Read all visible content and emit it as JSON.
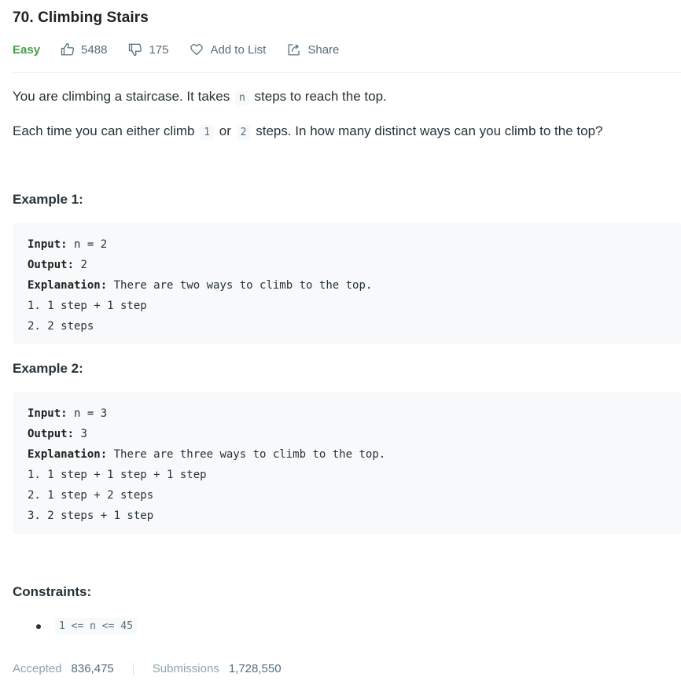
{
  "problem": {
    "title": "70. Climbing Stairs",
    "difficulty": "Easy",
    "likes": "5488",
    "dislikes": "175",
    "add_to_list_label": "Add to List",
    "share_label": "Share"
  },
  "description": {
    "p1": {
      "before": "You are climbing a staircase. It takes",
      "code": "n",
      "after": "steps to reach the top."
    },
    "p2": {
      "before": "Each time you can either climb",
      "code1": "1",
      "mid": "or",
      "code2": "2",
      "after": "steps. In how many distinct ways can you climb to the top?"
    }
  },
  "examples": [
    {
      "heading": "Example 1:",
      "input_label": "Input:",
      "input_value": "n = 2",
      "output_label": "Output:",
      "output_value": "2",
      "explanation_label": "Explanation:",
      "explanation_value": "There are two ways to climb to the top.",
      "lines": [
        "1. 1 step + 1 step",
        "2. 2 steps"
      ]
    },
    {
      "heading": "Example 2:",
      "input_label": "Input:",
      "input_value": "n = 3",
      "output_label": "Output:",
      "output_value": "3",
      "explanation_label": "Explanation:",
      "explanation_value": "There are three ways to climb to the top.",
      "lines": [
        "1. 1 step + 1 step + 1 step",
        "2. 1 step + 2 steps",
        "3. 2 steps + 1 step"
      ]
    }
  ],
  "constraints": {
    "heading": "Constraints:",
    "items": [
      "1 <= n <= 45"
    ]
  },
  "stats": {
    "accepted_label": "Accepted",
    "accepted_value": "836,475",
    "submissions_label": "Submissions",
    "submissions_value": "1,728,550"
  },
  "colors": {
    "easy": "#43a047",
    "text": "#263238",
    "muted": "#546e7a",
    "code_bg": "#f7f9fa"
  },
  "icons": [
    "thumbs-up-icon",
    "thumbs-down-icon",
    "heart-icon",
    "share-icon"
  ]
}
